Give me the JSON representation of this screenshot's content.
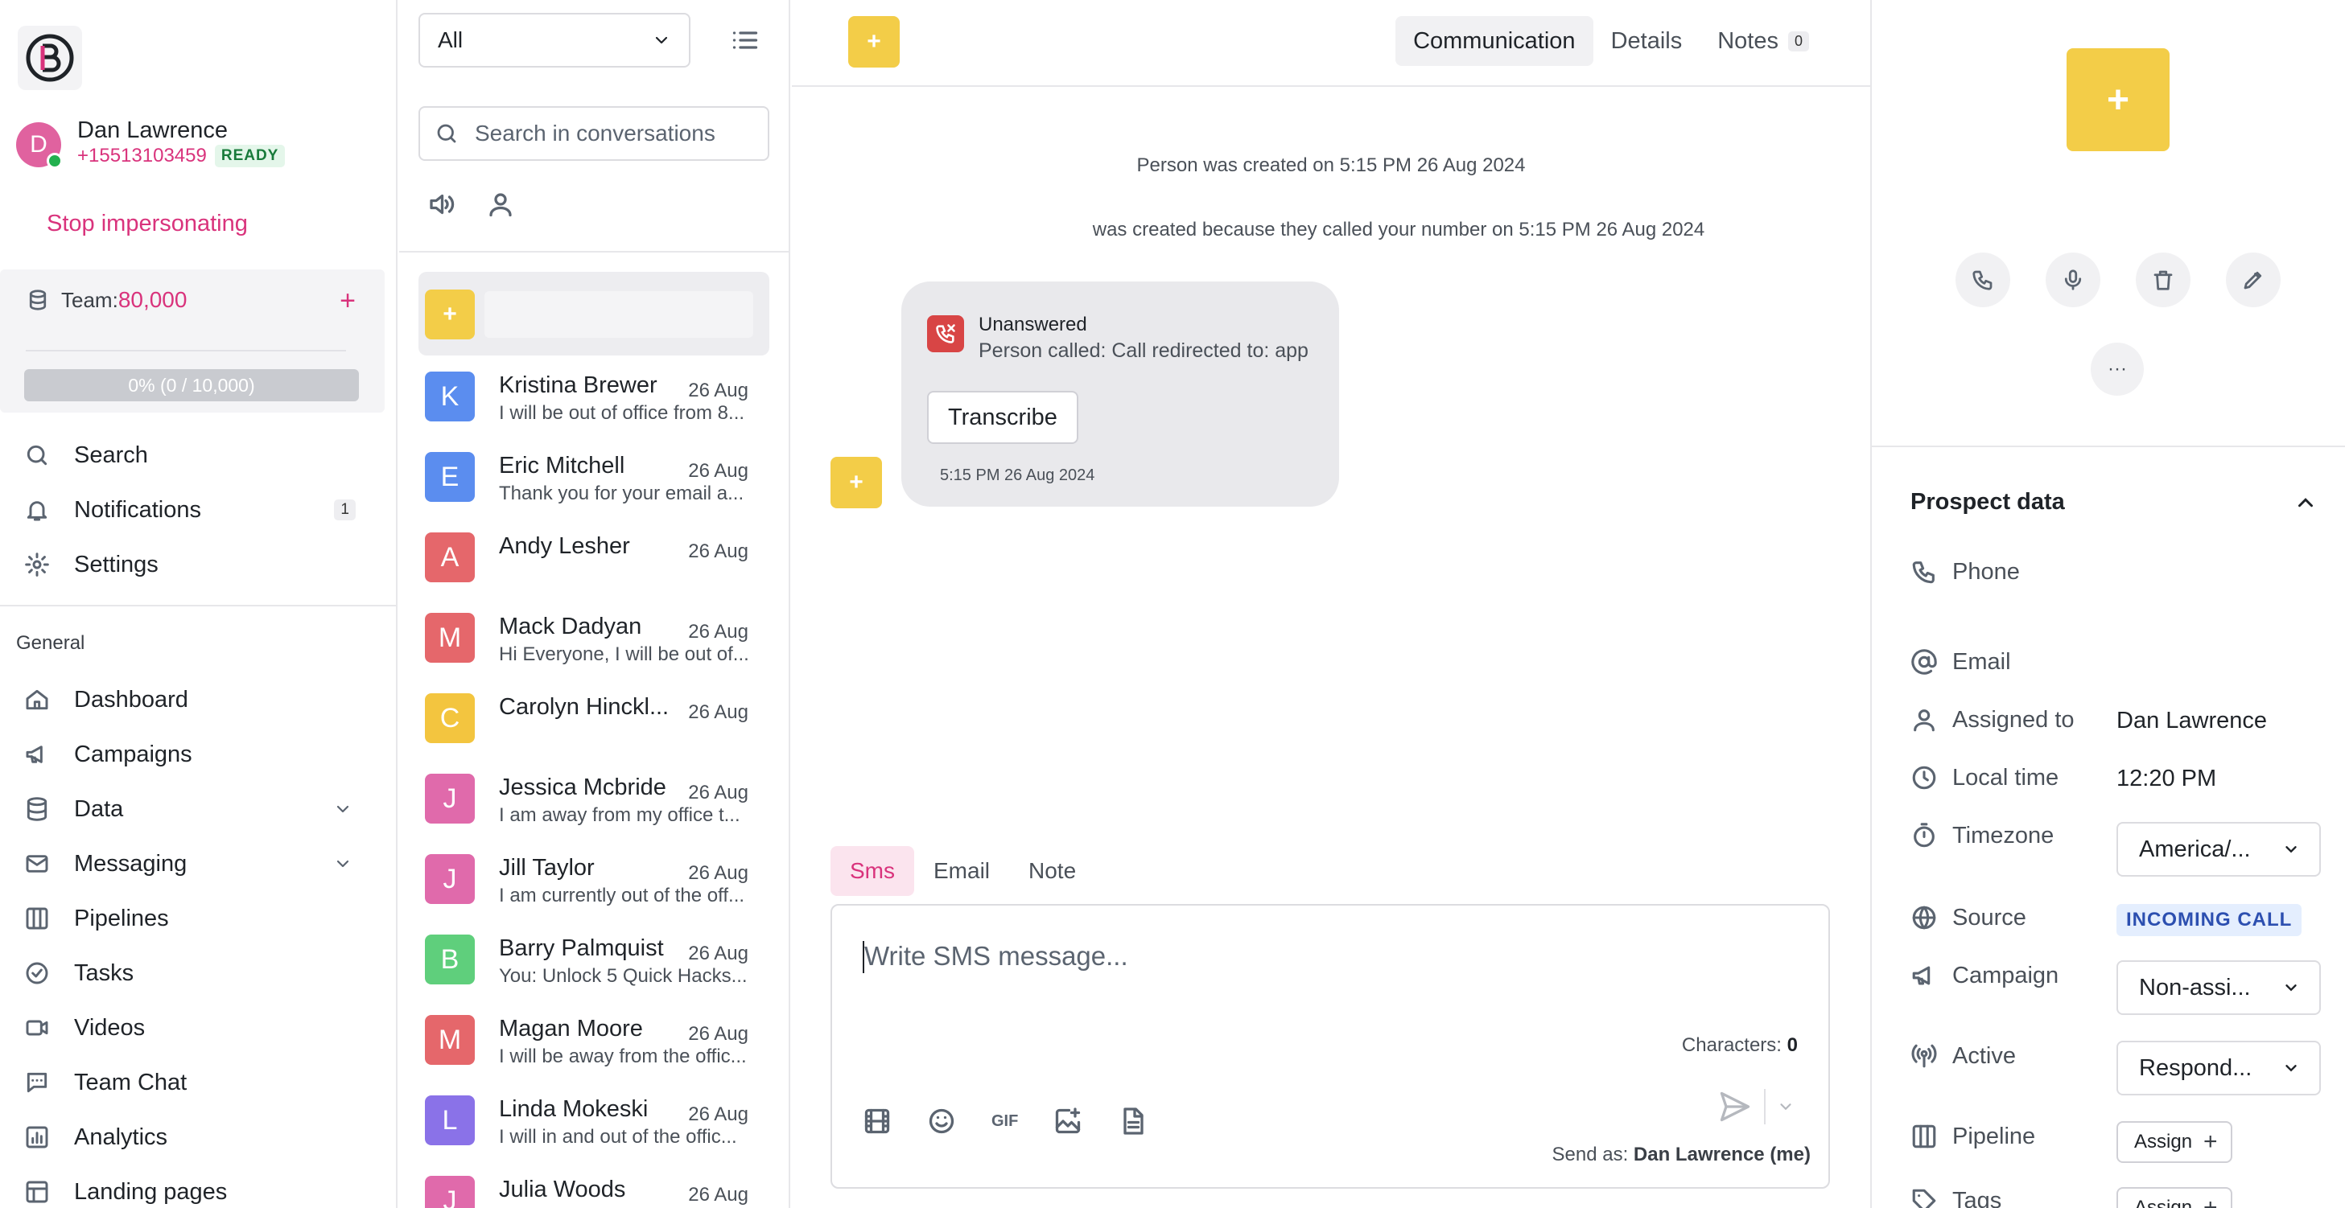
{
  "user": {
    "initial": "D",
    "name": "Dan Lawrence",
    "phone": "+15513103459",
    "status": "READY",
    "stop_impersonating": "Stop impersonating"
  },
  "team": {
    "label": "Team:",
    "value": "80,000",
    "progress_text": "0% (0 / 10,000)",
    "progress_percent": 0
  },
  "nav_top": [
    {
      "label": "Search",
      "icon": "search-icon"
    },
    {
      "label": "Notifications",
      "icon": "bell-icon",
      "badge": "1"
    },
    {
      "label": "Settings",
      "icon": "gear-icon"
    }
  ],
  "section_general": "General",
  "nav_general": [
    {
      "label": "Dashboard",
      "icon": "home-icon"
    },
    {
      "label": "Campaigns",
      "icon": "megaphone-icon"
    },
    {
      "label": "Data",
      "icon": "database-icon",
      "expandable": true
    },
    {
      "label": "Messaging",
      "icon": "mail-icon",
      "expandable": true
    },
    {
      "label": "Pipelines",
      "icon": "columns-icon"
    },
    {
      "label": "Tasks",
      "icon": "check-circle-icon"
    },
    {
      "label": "Videos",
      "icon": "video-icon"
    },
    {
      "label": "Team Chat",
      "icon": "chat-icon"
    },
    {
      "label": "Analytics",
      "icon": "chart-icon"
    },
    {
      "label": "Landing pages",
      "icon": "layout-icon"
    }
  ],
  "conversations": {
    "filter_value": "All",
    "search_placeholder": "Search in conversations",
    "items": [
      {
        "initial": "K",
        "color": "#5b8def",
        "name": "Kristina Brewer",
        "date": "26 Aug",
        "preview": "I will be out of office from 8..."
      },
      {
        "initial": "E",
        "color": "#5b8def",
        "name": "Eric Mitchell",
        "date": "26 Aug",
        "preview": "Thank you for your email a..."
      },
      {
        "initial": "A",
        "color": "#e5676b",
        "name": "Andy Lesher",
        "date": "26 Aug",
        "preview": ""
      },
      {
        "initial": "M",
        "color": "#e5676b",
        "name": "Mack Dadyan",
        "date": "26 Aug",
        "preview": "Hi Everyone, I will be out of..."
      },
      {
        "initial": "C",
        "color": "#f3c53f",
        "name": "Carolyn Hinckl...",
        "date": "26 Aug",
        "preview": ""
      },
      {
        "initial": "J",
        "color": "#e06aab",
        "name": "Jessica Mcbride",
        "date": "26 Aug",
        "preview": "I am away from my office t..."
      },
      {
        "initial": "J",
        "color": "#e06aab",
        "name": "Jill Taylor",
        "date": "26 Aug",
        "preview": "I am currently out of the off..."
      },
      {
        "initial": "B",
        "color": "#5fcf7c",
        "name": "Barry Palmquist",
        "date": "26 Aug",
        "preview": "You: Unlock 5 Quick Hacks..."
      },
      {
        "initial": "M",
        "color": "#e5676b",
        "name": "Magan Moore",
        "date": "26 Aug",
        "preview": "I will be away from the offic..."
      },
      {
        "initial": "L",
        "color": "#8a72e8",
        "name": "Linda Mokeski",
        "date": "26 Aug",
        "preview": "I will in and out of the offic..."
      },
      {
        "initial": "J",
        "color": "#e06aab",
        "name": "Julia Woods",
        "date": "26 Aug",
        "preview": ""
      }
    ]
  },
  "main": {
    "tabs": [
      {
        "label": "Communication",
        "active": true
      },
      {
        "label": "Details"
      },
      {
        "label": "Notes",
        "count": "0"
      }
    ],
    "events": [
      "Person was created on 5:15 PM 26 Aug 2024",
      "was created because they called your number on 5:15 PM 26 Aug 2024"
    ],
    "call": {
      "title": "Unanswered",
      "subtitle": "Person called: Call redirected to: app",
      "transcribe": "Transcribe",
      "time": "5:15 PM 26 Aug 2024"
    },
    "composer_tabs": [
      {
        "label": "Sms",
        "active": true
      },
      {
        "label": "Email"
      },
      {
        "label": "Note"
      }
    ],
    "composer": {
      "placeholder": "Write SMS message...",
      "characters_label": "Characters:",
      "characters_value": "0",
      "send_as_label": "Send as:",
      "send_as_value": "Dan Lawrence (me)",
      "gif": "GIF"
    }
  },
  "prospect": {
    "title": "Prospect data",
    "phone_label": "Phone",
    "email_label": "Email",
    "assigned_label": "Assigned to",
    "assigned_value": "Dan Lawrence",
    "local_time_label": "Local time",
    "local_time_value": "12:20 PM",
    "timezone_label": "Timezone",
    "timezone_value": "America/...",
    "source_label": "Source",
    "source_value": "INCOMING CALL",
    "campaign_label": "Campaign",
    "campaign_value": "Non-assi...",
    "active_label": "Active",
    "active_value": "Respond...",
    "pipeline_label": "Pipeline",
    "pipeline_button": "Assign",
    "tags_label": "Tags",
    "tags_button": "Assign"
  },
  "colors": {
    "accent_pink": "#d9337c",
    "accent_yellow": "#f3cd48",
    "status_green": "#22b04e",
    "missed_call_red": "#d84545"
  }
}
